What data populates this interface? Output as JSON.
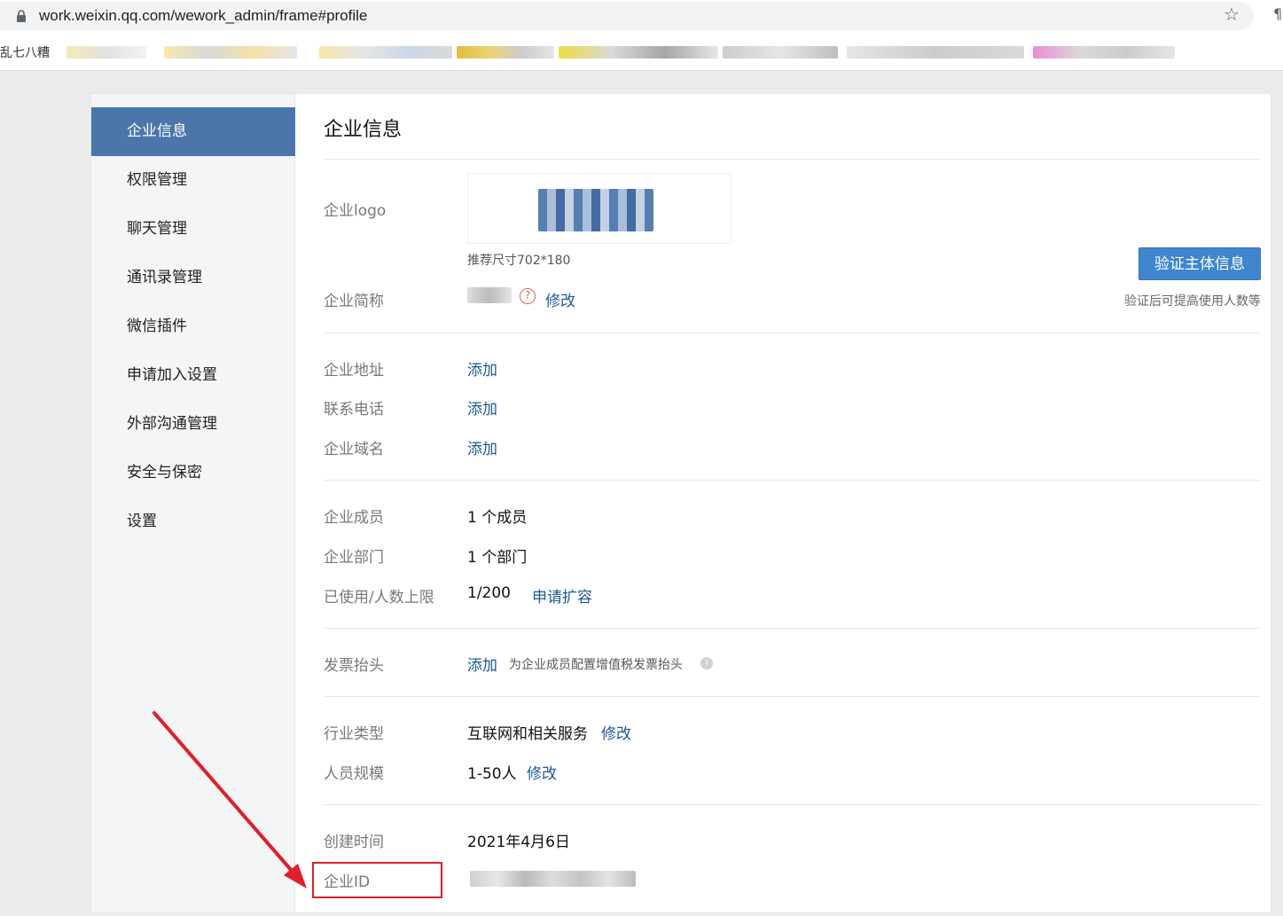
{
  "browser": {
    "url": "work.weixin.qq.com/wework_admin/frame#profile",
    "bookmark_first": "乱七八糟"
  },
  "sidebar": {
    "items": [
      {
        "label": "企业信息",
        "active": true
      },
      {
        "label": "权限管理"
      },
      {
        "label": "聊天管理"
      },
      {
        "label": "通讯录管理"
      },
      {
        "label": "微信插件"
      },
      {
        "label": "申请加入设置"
      },
      {
        "label": "外部沟通管理"
      },
      {
        "label": "安全与保密"
      },
      {
        "label": "设置"
      }
    ]
  },
  "main": {
    "title": "企业信息",
    "logo": {
      "label": "企业logo",
      "hint": "推荐尺寸702*180"
    },
    "verify_button": "验证主体信息",
    "verify_hint": "验证后可提高使用人数等",
    "short_name": {
      "label": "企业简称",
      "action": "修改"
    },
    "address": {
      "label": "企业地址",
      "action": "添加"
    },
    "phone": {
      "label": "联系电话",
      "action": "添加"
    },
    "domain": {
      "label": "企业域名",
      "action": "添加"
    },
    "members": {
      "label": "企业成员",
      "value": "1 个成员"
    },
    "departments": {
      "label": "企业部门",
      "value": "1 个部门"
    },
    "limit": {
      "label": "已使用/人数上限",
      "value": "1/200",
      "action": "申请扩容"
    },
    "invoice": {
      "label": "发票抬头",
      "action": "添加",
      "hint": "为企业成员配置增值税发票抬头"
    },
    "industry": {
      "label": "行业类型",
      "value": "互联网和相关服务",
      "action": "修改"
    },
    "size": {
      "label": "人员规模",
      "value": "1-50人",
      "action": "修改"
    },
    "created": {
      "label": "创建时间",
      "value": "2021年4月6日"
    },
    "corp_id": {
      "label": "企业ID"
    }
  },
  "colors": {
    "accent": "#4a76ac",
    "link": "#1d5a9a",
    "button": "#3f86ce",
    "annotation": "#e21e2a"
  }
}
